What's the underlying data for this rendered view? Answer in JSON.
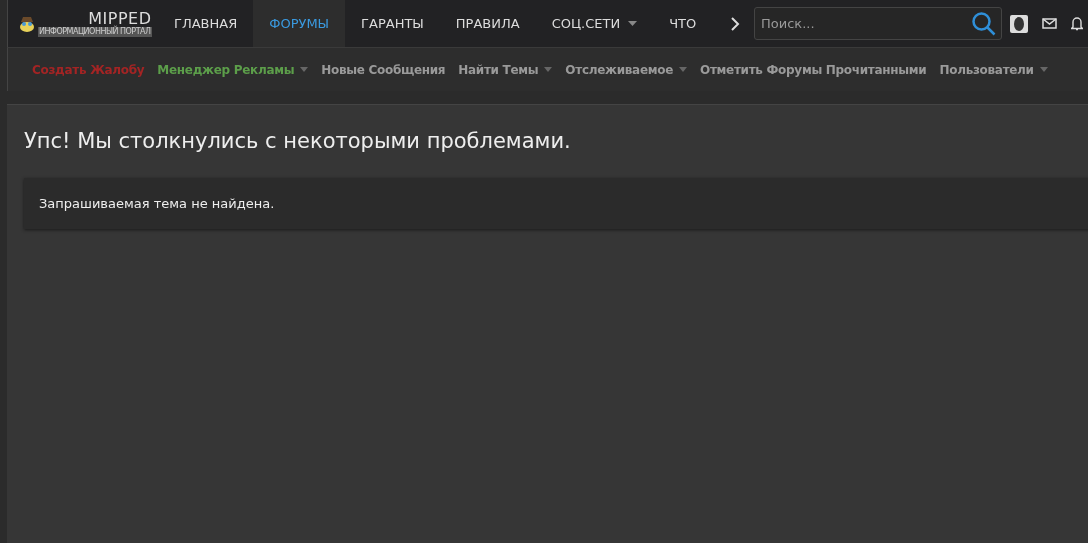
{
  "logo": {
    "title": "MIPPED",
    "subtitle": "ИНФОРМАЦИОННЫЙ ПОРТАЛ"
  },
  "nav": [
    {
      "label": "ГЛАВНАЯ",
      "selected": false,
      "dropdown": false
    },
    {
      "label": "ФОРУМЫ",
      "selected": true,
      "dropdown": false
    },
    {
      "label": "ГАРАНТЫ",
      "selected": false,
      "dropdown": false
    },
    {
      "label": "ПРАВИЛА",
      "selected": false,
      "dropdown": false
    },
    {
      "label": "СОЦ.СЕТИ",
      "selected": false,
      "dropdown": true
    },
    {
      "label": "ЧТО",
      "selected": false,
      "dropdown": false
    }
  ],
  "search": {
    "placeholder": "Поиск..."
  },
  "subnav": [
    {
      "label": "Создать Жалобу",
      "color": "#a32424",
      "dropdown": false
    },
    {
      "label": "Менеджер Рекламы",
      "color": "#5c9e4a",
      "dropdown": true
    },
    {
      "label": "Новые Сообщения",
      "color": "#9a9a9a",
      "dropdown": false
    },
    {
      "label": "Найти Темы",
      "color": "#9a9a9a",
      "dropdown": true
    },
    {
      "label": "Отслеживаемое",
      "color": "#9a9a9a",
      "dropdown": true
    },
    {
      "label": "Отметить Форумы Прочитанными",
      "color": "#9a9a9a",
      "dropdown": false
    },
    {
      "label": "Пользователи",
      "color": "#9a9a9a",
      "dropdown": true
    }
  ],
  "error": {
    "title": "Упс! Мы столкнулись с некоторыми проблемами.",
    "message": "Запрашиваемая тема не найдена."
  }
}
